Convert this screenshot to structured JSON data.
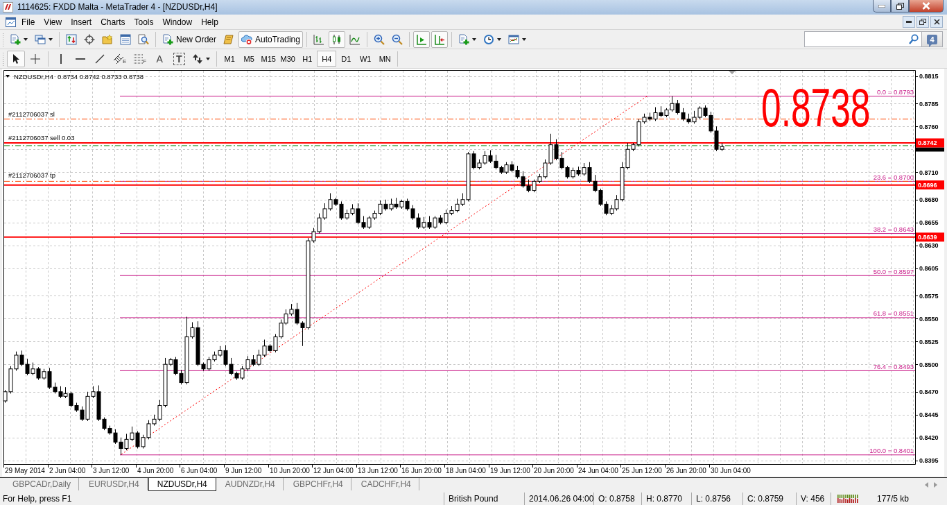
{
  "window": {
    "title": "1114625: FXDD Malta - MetaTrader 4 - [NZDUSDr,H4]"
  },
  "menu": {
    "items": [
      "File",
      "View",
      "Insert",
      "Charts",
      "Tools",
      "Window",
      "Help"
    ]
  },
  "toolbar": {
    "groups": [
      [
        {
          "kind": "new-chart",
          "pressed": false
        },
        {
          "kind": "profiles",
          "pressed": false
        }
      ],
      [
        {
          "kind": "market-watch",
          "pressed": false
        },
        {
          "kind": "navigator",
          "pressed": false
        },
        {
          "kind": "data-window",
          "pressed": false
        },
        {
          "kind": "terminal",
          "pressed": false
        },
        {
          "kind": "tester",
          "pressed": false
        }
      ],
      [
        {
          "kind": "new-order",
          "label": "New Order",
          "pressed": false
        },
        {
          "kind": "editor",
          "pressed": false
        },
        {
          "kind": "autotrading",
          "label": "AutoTrading",
          "pressed": true
        }
      ],
      [
        {
          "kind": "bar-chart",
          "pressed": false
        },
        {
          "kind": "candle-chart",
          "pressed": true
        },
        {
          "kind": "line-chart",
          "pressed": false
        }
      ],
      [
        {
          "kind": "zoom-in",
          "pressed": false
        },
        {
          "kind": "zoom-out",
          "pressed": false
        }
      ],
      [
        {
          "kind": "auto-scroll",
          "pressed": true
        },
        {
          "kind": "chart-shift",
          "pressed": true
        }
      ],
      [
        {
          "kind": "indicators",
          "pressed": false
        },
        {
          "kind": "periodicity",
          "pressed": false
        },
        {
          "kind": "templates",
          "pressed": false
        }
      ]
    ]
  },
  "messages": {
    "count": "4"
  },
  "drawing_tools": {
    "groups": [
      [
        {
          "kind": "cursor",
          "selected": true
        },
        {
          "kind": "crosshair",
          "selected": false
        }
      ],
      [
        {
          "kind": "vertical-line",
          "selected": false
        },
        {
          "kind": "horizontal-line",
          "selected": false
        },
        {
          "kind": "trendline",
          "selected": false
        },
        {
          "kind": "channel",
          "glyph": "E",
          "selected": false
        },
        {
          "kind": "fibonacci",
          "glyph": "F",
          "selected": false
        },
        {
          "kind": "text",
          "glyph": "A",
          "selected": false
        },
        {
          "kind": "label",
          "glyph": "T",
          "selected": false
        },
        {
          "kind": "arrows",
          "selected": false
        }
      ]
    ]
  },
  "periods": [
    {
      "label": "M1",
      "selected": false
    },
    {
      "label": "M5",
      "selected": false
    },
    {
      "label": "M15",
      "selected": false
    },
    {
      "label": "M30",
      "selected": false
    },
    {
      "label": "H1",
      "selected": false
    },
    {
      "label": "H4",
      "selected": true
    },
    {
      "label": "D1",
      "selected": false
    },
    {
      "label": "W1",
      "selected": false
    },
    {
      "label": "MN",
      "selected": false
    }
  ],
  "chart": {
    "symbol": "NZDUSDr,H4",
    "ohlc": "0.8734 0.8742 0.8733 0.8738",
    "big_price": "0.8738",
    "orders": [
      {
        "kind": "sl",
        "label": "#2112706037 sl"
      },
      {
        "kind": "open",
        "label": "#2112706037 sell 0.03"
      },
      {
        "kind": "tp",
        "label": "#2112706037 tp"
      }
    ],
    "fibonacci": [
      {
        "label": "0.0 = 0.8793"
      },
      {
        "label": "23.6 = 0.8700"
      },
      {
        "label": "38.2 = 0.8643"
      },
      {
        "label": "50.0 = 0.8597"
      },
      {
        "label": "61.8 = 0.8551"
      },
      {
        "label": "76.4 = 0.8493"
      },
      {
        "label": "100.0 = 0.8401"
      }
    ],
    "price_lines": [
      {
        "label": "0.8742"
      },
      {
        "label": "0.8696"
      },
      {
        "label": "0.8639"
      }
    ],
    "price_axis": [
      "0.8815",
      "0.8785",
      "0.8760",
      "0.8710",
      "0.8680",
      "0.8655",
      "0.8630",
      "0.8605",
      "0.8575",
      "0.8550",
      "0.8525",
      "0.8500",
      "0.8470",
      "0.8445",
      "0.8420",
      "0.8395"
    ],
    "time_axis": [
      "29 May 2014",
      "2 Jun 04:00",
      "3 Jun 12:00",
      "4 Jun 20:00",
      "6 Jun 04:00",
      "9 Jun 12:00",
      "10 Jun 20:00",
      "12 Jun 04:00",
      "13 Jun 12:00",
      "16 Jun 20:00",
      "18 Jun 04:00",
      "19 Jun 12:00",
      "20 Jun 20:00",
      "24 Jun 04:00",
      "25 Jun 12:00",
      "26 Jun 20:00",
      "30 Jun 04:00"
    ]
  },
  "tabs": [
    {
      "label": "GBPCADr,Daily",
      "selected": false
    },
    {
      "label": "EURUSDr,H4",
      "selected": false
    },
    {
      "label": "NZDUSDr,H4",
      "selected": true
    },
    {
      "label": "AUDNZDr,H4",
      "selected": false
    },
    {
      "label": "GBPCHFr,H4",
      "selected": false
    },
    {
      "label": "CADCHFr,H4",
      "selected": false
    }
  ],
  "status_bar": {
    "help": "For Help, press F1",
    "fields": [
      "British Pound",
      "2014.06.26 04:00",
      "O: 0.8758",
      "H: 0.8770",
      "L: 0.8756",
      "C: 0.8759",
      "V: 456"
    ],
    "traffic": "177/5 kb"
  }
}
